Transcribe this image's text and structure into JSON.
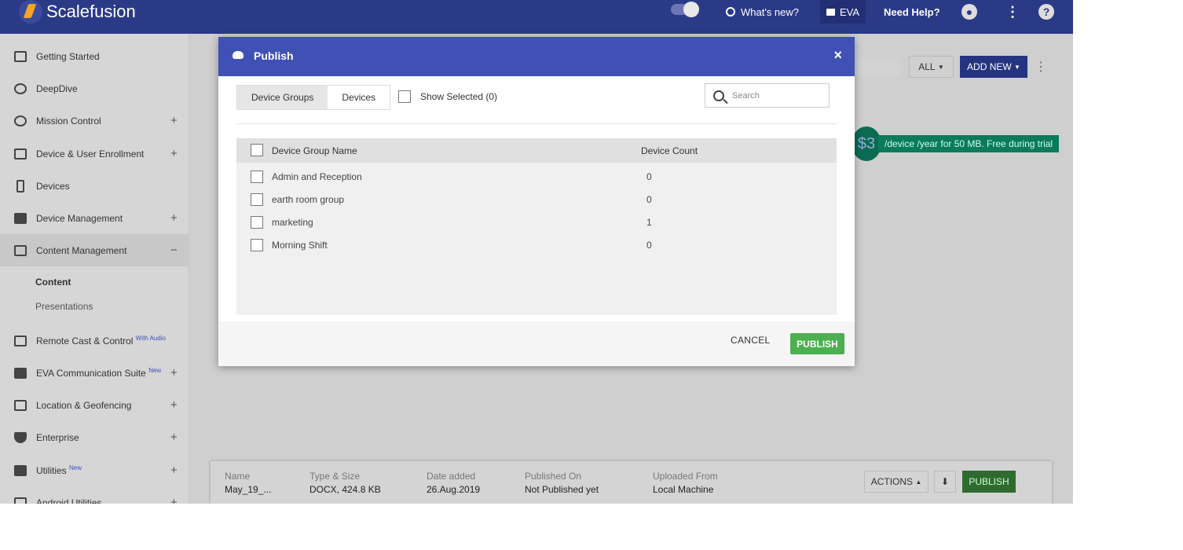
{
  "topbar": {
    "app_name": "Scalefusion",
    "whats_new": "What's new?",
    "eva": "EVA",
    "need_help": "Need Help?",
    "help_icon": "?"
  },
  "sidebar": {
    "items": [
      {
        "label": "Getting Started",
        "icon": "getting-started-icon",
        "expand": ""
      },
      {
        "label": "DeepDive",
        "icon": "dashboard-icon",
        "expand": ""
      },
      {
        "label": "Mission Control",
        "icon": "mission-control-icon",
        "expand": "+"
      },
      {
        "label": "Device & User Enrollment",
        "icon": "enrollment-icon",
        "expand": "+"
      },
      {
        "label": "Devices",
        "icon": "phone-icon",
        "expand": ""
      },
      {
        "label": "Device Management",
        "icon": "briefcase-icon",
        "expand": "+"
      },
      {
        "label": "Content Management",
        "icon": "folder-icon",
        "expand": "−"
      },
      {
        "label": "Remote Cast & Control",
        "badge": "With Audio",
        "icon": "cast-icon",
        "expand": ""
      },
      {
        "label": "EVA Communication Suite",
        "badge": "New",
        "icon": "chat-icon",
        "expand": "+"
      },
      {
        "label": "Location & Geofencing",
        "icon": "map-icon",
        "expand": "+"
      },
      {
        "label": "Enterprise",
        "icon": "shield-icon",
        "expand": "+"
      },
      {
        "label": "Utilities",
        "badge": "New",
        "icon": "widgets-icon",
        "expand": "+"
      },
      {
        "label": "Android Utilities",
        "icon": "android-icon",
        "expand": "+"
      }
    ],
    "sub_items": [
      "Content",
      "Presentations"
    ]
  },
  "page": {
    "all_label": "ALL",
    "add_new_label": "ADD NEW",
    "promo_dollar": "$3",
    "promo_text": "/device /year for 50 MB. Free during trial",
    "bottom": {
      "name_k": "Name",
      "name_v": "May_19_...",
      "type_k": "Type & Size",
      "type_v": "DOCX, 424.8 KB",
      "date_k": "Date added",
      "date_v": "26.Aug.2019",
      "pub_k": "Published On",
      "pub_v": "Not Published yet",
      "up_k": "Uploaded From",
      "up_v": "Local Machine",
      "actions": "ACTIONS",
      "publish": "PUBLISH"
    }
  },
  "modal": {
    "title": "Publish",
    "close": "×",
    "tabs": [
      "Device Groups",
      "Devices"
    ],
    "show_selected": "Show Selected (0)",
    "search_placeholder": "Search",
    "columns": [
      "Device Group Name",
      "Device Count"
    ],
    "rows": [
      {
        "name": "Admin and Reception",
        "count": "0"
      },
      {
        "name": "earth room group",
        "count": "0"
      },
      {
        "name": "marketing",
        "count": "1"
      },
      {
        "name": "Morning Shift",
        "count": "0"
      }
    ],
    "cancel": "CANCEL",
    "publish": "PUBLISH"
  }
}
